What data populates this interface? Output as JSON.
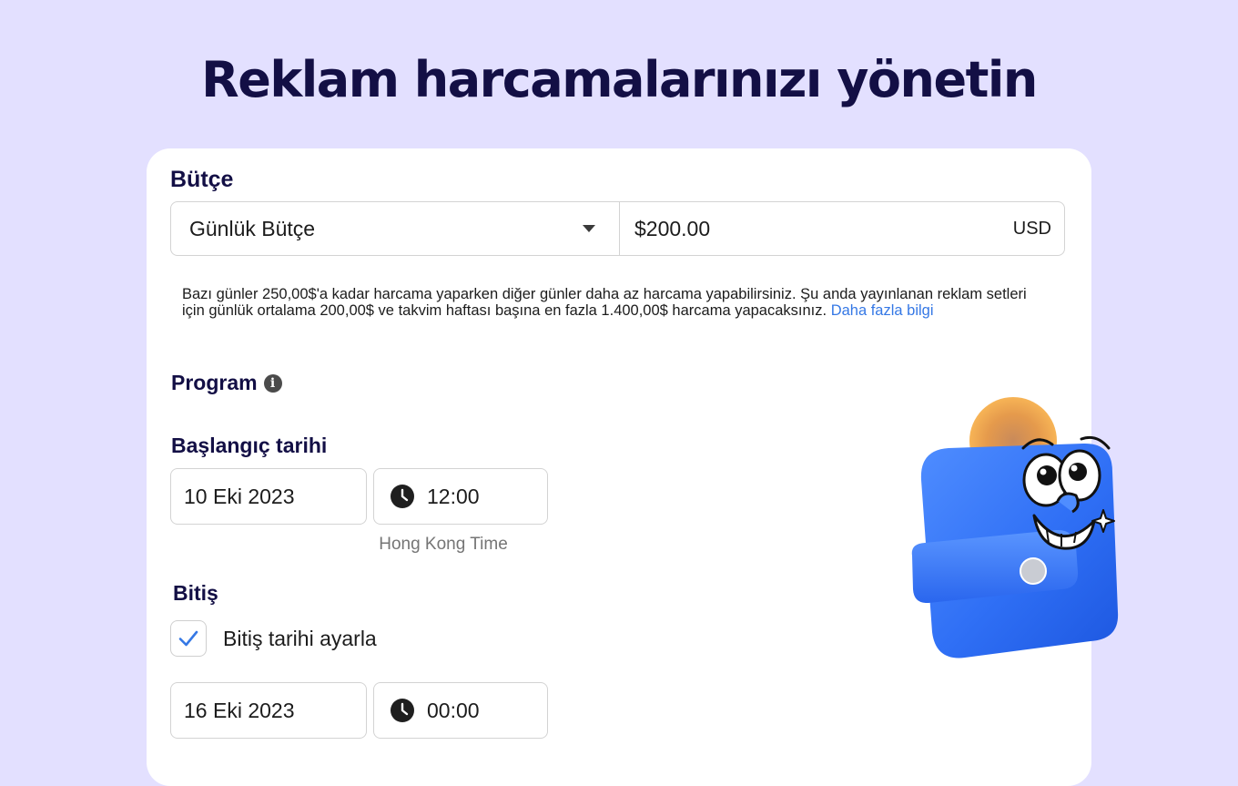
{
  "hero": {
    "title": "Reklam harcamalarınızı yönetin"
  },
  "budget": {
    "label": "Bütçe",
    "type_selected": "Günlük Bütçe",
    "amount": "$200.00",
    "currency": "USD",
    "help_text": "Bazı günler 250,00$'a kadar harcama yaparken diğer günler daha az harcama yapabilirsiniz. Şu anda yayınlanan reklam setleri için günlük ortalama 200,00$ ve takvim haftası başına en fazla 1.400,00$ harcama yapacaksınız.",
    "help_link": "Daha fazla bilgi"
  },
  "program": {
    "label": "Program",
    "start": {
      "label": "Başlangıç tarihi",
      "date": "10 Eki 2023",
      "time": "12:00",
      "timezone": "Hong Kong Time"
    },
    "end": {
      "label": "Bitiş",
      "checkbox_label": "Bitiş tarihi ayarla",
      "checkbox_checked": true,
      "date": "16 Eki 2023",
      "time": "00:00"
    }
  },
  "icons": {
    "dropdown": "caret-down-icon",
    "info": "info-icon",
    "clock": "clock-icon",
    "check": "check-icon",
    "illustration": "wallet-mascot-illustration"
  },
  "colors": {
    "background": "#e3e0ff",
    "title": "#130f45",
    "link": "#3578e5",
    "wallet": "#2f6ff5",
    "coin": "#f2a54a"
  }
}
